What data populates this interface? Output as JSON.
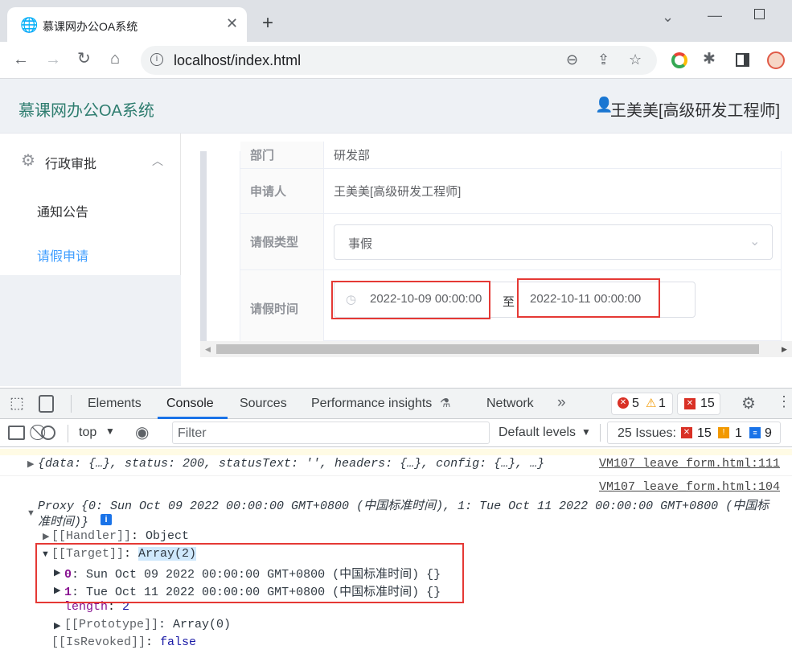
{
  "browser": {
    "tab_title": "慕课网办公OA系统",
    "url": "localhost/index.html"
  },
  "app": {
    "title": "慕课网办公OA系统",
    "user": "王美美[高级研发工程师]"
  },
  "sidebar": {
    "group": "行政审批",
    "items": [
      {
        "label": "通知公告"
      },
      {
        "label": "请假申请"
      }
    ]
  },
  "form": {
    "partial_label": "部门",
    "partial_value": "研发部",
    "applicant_label": "申请人",
    "applicant_value": "王美美[高级研发工程师]",
    "type_label": "请假类型",
    "type_value": "事假",
    "time_label": "请假时间",
    "start": "2022-10-09 00:00:00",
    "sep": "至",
    "end": "2022-10-11 00:00:00"
  },
  "devtools": {
    "tabs": [
      "Elements",
      "Console",
      "Sources",
      "Performance insights",
      "Network"
    ],
    "errors": "5",
    "warnings": "1",
    "issues_badge": "15",
    "context": "top",
    "filter_placeholder": "Filter",
    "levels": "Default levels",
    "issues_label": "25 Issues:",
    "issues_err": "15",
    "issues_warn": "1",
    "issues_info": "9",
    "log1": "{data: {…}, status: 200, statusText: '', headers: {…}, config: {…}, …}",
    "src1": "VM107 leave_form.html:111",
    "src2": "VM107 leave_form.html:104",
    "proxy_line1": "Proxy {0: Sun Oct 09 2022 00:00:00 GMT+0800 (中国标准时间), 1: Tue Oct 11 2022 00:00:00 GMT+0800 (中国标",
    "proxy_line2": "准时间)}",
    "handler_key": "[[Handler]]",
    "handler_val": "Object",
    "target_key": "[[Target]]",
    "target_val": "Array(2)",
    "item0_key": "0",
    "item0_val": "Sun Oct 09 2022 00:00:00 GMT+0800 (中国标准时间) {}",
    "item1_key": "1",
    "item1_val": "Tue Oct 11 2022 00:00:00 GMT+0800 (中国标准时间) {}",
    "length_key": "length",
    "length_val": "2",
    "proto_key": "[[Prototype]]",
    "proto_val": "Array(0)",
    "revoked_key": "[[IsRevoked]]",
    "revoked_val": "false"
  },
  "colors": {
    "accent": "#409eff",
    "title_green": "#2e7d6f",
    "highlight": "#e53935"
  }
}
